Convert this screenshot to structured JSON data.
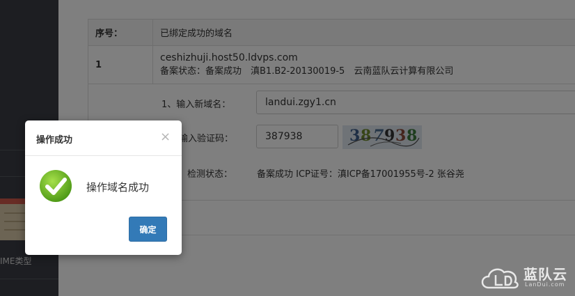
{
  "sidebar": {
    "mime_label": "IME类型"
  },
  "table": {
    "header": {
      "col1": "序号：",
      "col2": "已绑定成功的域名"
    },
    "row": {
      "index": "1",
      "domain": "ceshizhuji.host50.ldvps.com",
      "record": "备案状态：备案成功　滇B1.B2-20130019-5　云南蓝队云计算有限公司"
    }
  },
  "form": {
    "new_domain_label": "1、输入新域名：",
    "new_domain_value": "landui.zgy1.cn",
    "captcha_label": "输入验证码：",
    "captcha_value": "387938",
    "captcha_chars": [
      {
        "ch": "3",
        "color": "#3f5f8a"
      },
      {
        "ch": "8",
        "color": "#6e8a2f"
      },
      {
        "ch": "7",
        "color": "#4a6a8f"
      },
      {
        "ch": "9",
        "color": "#333333"
      },
      {
        "ch": "3",
        "color": "#8a4a3a"
      },
      {
        "ch": "8",
        "color": "#3c7a3c"
      }
    ],
    "status_label": "检测状态：",
    "status_value": "备案成功 ICP证号：滇ICP备17001955号-2 张谷尧"
  },
  "modal": {
    "title": "操作成功",
    "close_glyph": "×",
    "icon": "check-circle-icon",
    "message": "操作域名成功",
    "ok_label": "确定"
  },
  "logo": {
    "name": "蓝队云",
    "sub": "LanDui.com"
  },
  "colors": {
    "primary_button": "#337ab7",
    "success_green": "#6fbd2a"
  }
}
